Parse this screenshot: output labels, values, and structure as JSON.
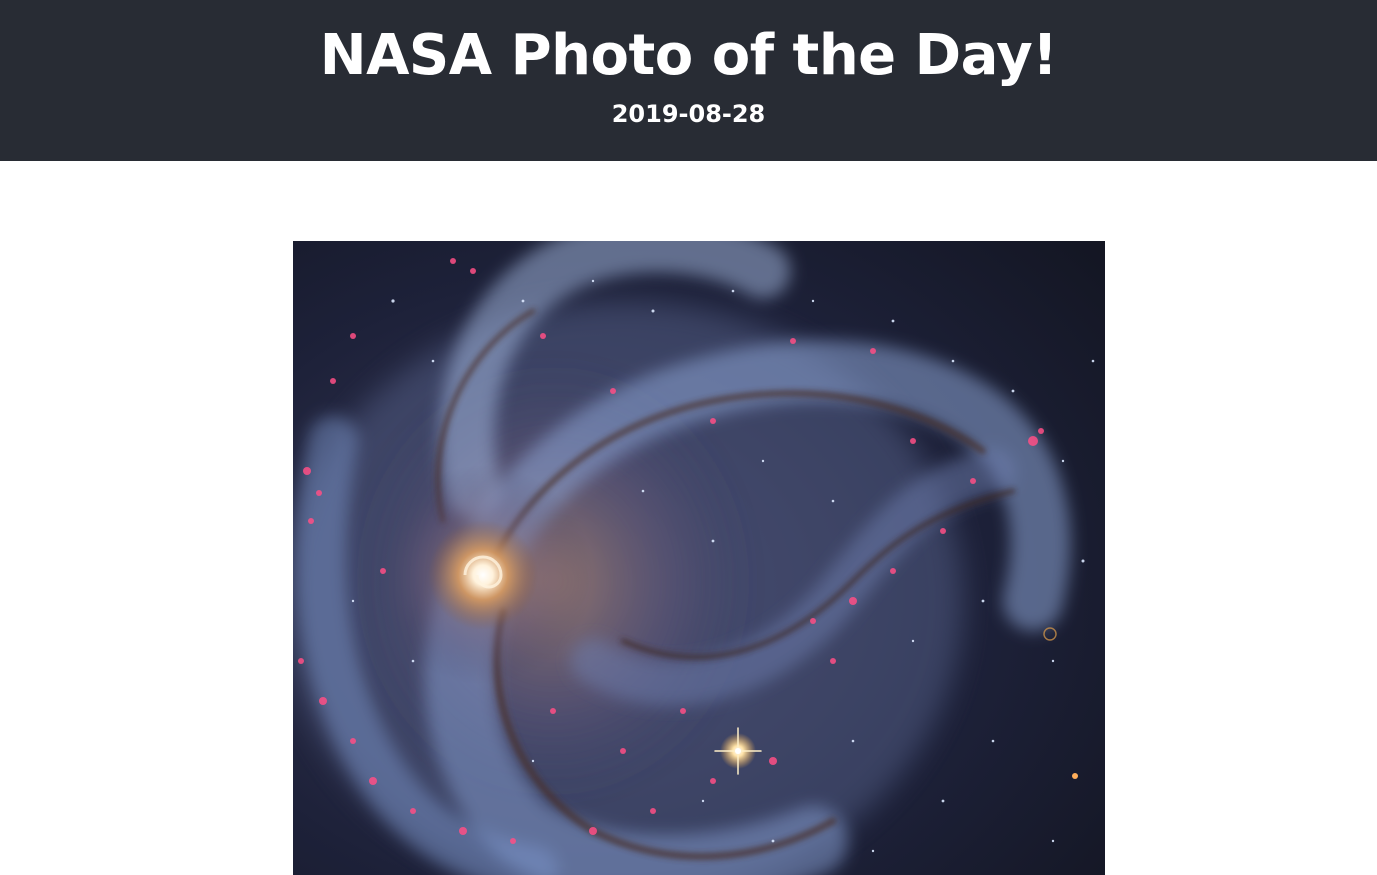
{
  "header": {
    "title": "NASA Photo of the Day!",
    "date": "2019-08-28",
    "background_color": "#282c34",
    "text_color": "#ffffff"
  },
  "photo": {
    "subject": "spiral galaxy",
    "palette": {
      "space": "#171a2c",
      "arm_blue": "#7f98c8",
      "core": "#ffe8c6",
      "dust": "#4a2e25",
      "star_forming": "#ff4f86"
    }
  }
}
